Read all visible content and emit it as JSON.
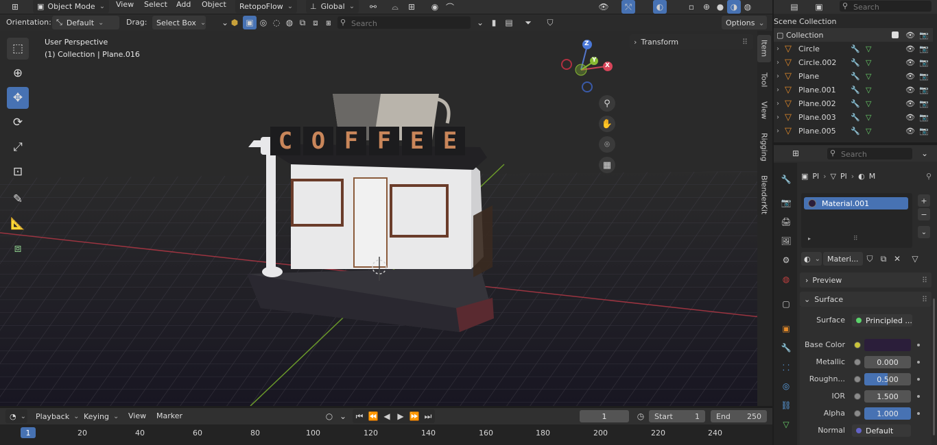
{
  "header": {
    "mode": "Object Mode",
    "menus": [
      "View",
      "Select",
      "Add",
      "Object"
    ],
    "addon": "RetopoFlow",
    "transform_space": "Global"
  },
  "tool_header": {
    "orientation_label": "Orientation:",
    "orientation_value": "Default",
    "drag_label": "Drag:",
    "drag_value": "Select Box",
    "search_placeholder": "Search",
    "options": "Options"
  },
  "viewport": {
    "perspective": "User Perspective",
    "context": "(1) Collection | Plane.016",
    "transform_panel": "Transform",
    "sign_letters": [
      "C",
      "O",
      "F",
      "F",
      "E",
      "E"
    ],
    "gizmo": {
      "z": "Z",
      "y": "Y",
      "x": "X"
    },
    "side_tabs": [
      "Item",
      "Tool",
      "View",
      "Rigging",
      "BlenderKit"
    ],
    "colors": {
      "bg": "#2a2a2a",
      "grid": "#3d3b45",
      "x_axis": "#9c3440",
      "y_axis": "#6b9a2a",
      "active": "#4772b3"
    }
  },
  "outliner": {
    "search_placeholder": "Search",
    "scene_collection": "Scene Collection",
    "collection": "Collection",
    "objects": [
      {
        "name": "Circle"
      },
      {
        "name": "Circle.002"
      },
      {
        "name": "Plane"
      },
      {
        "name": "Plane.001"
      },
      {
        "name": "Plane.002"
      },
      {
        "name": "Plane.003"
      },
      {
        "name": "Plane.005"
      }
    ]
  },
  "properties": {
    "search_placeholder": "Search",
    "breadcrumb": [
      "Pl",
      "Pl",
      "M"
    ],
    "material_slot": "Material.001",
    "material_name": "Materi...",
    "preview": "Preview",
    "surface_section": "Surface",
    "fields": {
      "surface_label": "Surface",
      "surface_value": "Principled ...",
      "base_color_label": "Base Color",
      "base_color": "#2b1e3a",
      "metallic_label": "Metallic",
      "metallic": "0.000",
      "roughness_label": "Roughn...",
      "roughness": "0.500",
      "roughness_fraction": 0.5,
      "ior_label": "IOR",
      "ior": "1.500",
      "alpha_label": "Alpha",
      "alpha": "1.000",
      "alpha_fraction": 1.0,
      "normal_label": "Normal",
      "normal": "Default"
    }
  },
  "timeline": {
    "menus": [
      "Playback",
      "Keying",
      "View",
      "Marker"
    ],
    "current_frame": "1",
    "start_label": "Start",
    "start": "1",
    "end_label": "End",
    "end": "250",
    "ruler": [
      "1",
      "20",
      "40",
      "60",
      "80",
      "100",
      "120",
      "140",
      "160",
      "180",
      "200",
      "220",
      "240"
    ]
  }
}
